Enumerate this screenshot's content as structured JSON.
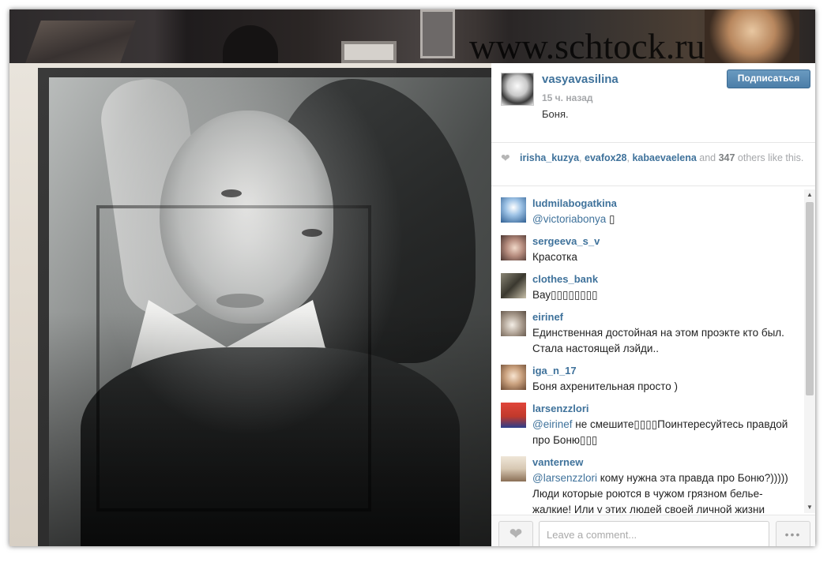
{
  "watermark": "www.schtock.ru",
  "post": {
    "username": "vasyavasilina",
    "time": "15 ч. назад",
    "caption": "Боня.",
    "follow_label": "Подписаться"
  },
  "likes": {
    "users": [
      "irisha_kuzya",
      "evafox28",
      "kabaevaelena"
    ],
    "sep1": ", ",
    "sep2": ", ",
    "and": " and ",
    "count": "347",
    "suffix": " others like this."
  },
  "comments": [
    {
      "user": "ludmilabogatkina",
      "mention": "@victoriabonya",
      "text": " ▯",
      "avatar_color": "#5b86b8"
    },
    {
      "user": "sergeeva_s_v",
      "mention": "",
      "text": "Красотка",
      "avatar_color": "#b58b7d"
    },
    {
      "user": "clothes_bank",
      "mention": "",
      "text": "Вау▯▯▯▯▯▯▯▯",
      "avatar_color": "#6d6a60"
    },
    {
      "user": "eirinef",
      "mention": "",
      "text": "Единственная достойная на этом проэкте кто был. Стала настоящей лэйди..",
      "avatar_color": "#a99b8d"
    },
    {
      "user": "iga_n_17",
      "mention": "",
      "text": "Боня ахренительная просто )",
      "avatar_color": "#c9a07d"
    },
    {
      "user": "larsenzzlori",
      "mention": "@eirinef",
      "text": " не смешите▯▯▯▯Поинтересуйтесь правдой про Боню▯▯▯",
      "avatar_color": "#c0392b"
    },
    {
      "user": "vanternew",
      "mention": "@larsenzzlori",
      "text": " кому нужна эта правда про Боню?))))) Люди которые роются в чужом грязном белье- жалкие! Или у этих людей своей личной жизни",
      "avatar_color": "#d7c8b3"
    }
  ],
  "footer": {
    "comment_placeholder": "Leave a comment...",
    "more_label": "•••"
  },
  "scroll": {
    "up": "▲",
    "down": "▼"
  },
  "colors": {
    "link": "#3f729b",
    "follow_bg": "#4c7ea8"
  }
}
